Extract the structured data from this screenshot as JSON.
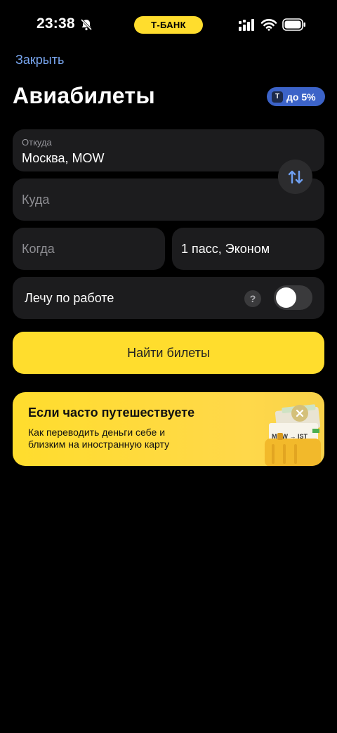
{
  "status_bar": {
    "time": "23:38",
    "bank_pill": "Т-БАНК",
    "icons": [
      "bell-slash-icon",
      "signal-icon",
      "wifi-icon",
      "battery-icon"
    ]
  },
  "header": {
    "close_label": "Закрыть",
    "title": "Авиабилеты",
    "cashback_logo": "Т",
    "cashback_label": "до 5%"
  },
  "form": {
    "from_label": "Откуда",
    "from_value": "Москва, MOW",
    "to_placeholder": "Куда",
    "when_placeholder": "Когда",
    "passengers_value": "1 пасс, Эконом",
    "swap_icon": "swap-arrows-icon",
    "business_trip_label": "Лечу по работе",
    "help_glyph": "?",
    "business_trip_enabled": false,
    "submit_label": "Найти билеты"
  },
  "promo": {
    "title": "Если часто путешествуете",
    "text": "Как переводить деньги себе и близким на иностранную карту",
    "ticket_text": "MOW → IST",
    "close_icon": "close-icon"
  },
  "colors": {
    "background": "#000000",
    "field": "#1c1c1e",
    "accent_yellow": "#ffdd2d",
    "link_blue": "#7aa8f2",
    "badge_blue": "#3c63c8"
  }
}
